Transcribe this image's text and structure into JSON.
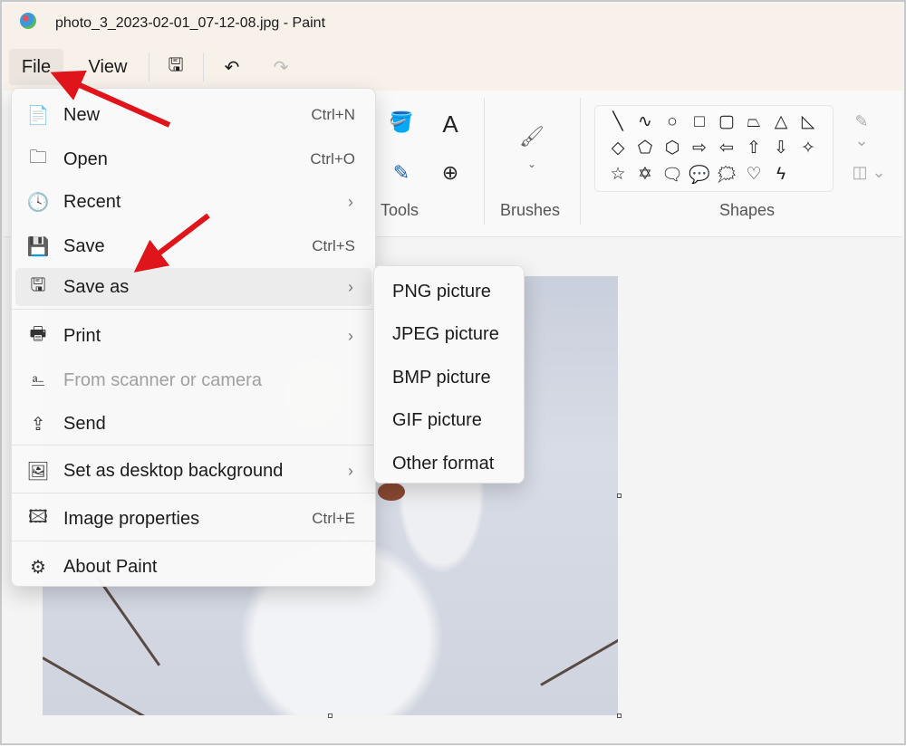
{
  "window": {
    "title": "photo_3_2023-02-01_07-12-08.jpg - Paint"
  },
  "toolbar": {
    "file": "File",
    "view": "View"
  },
  "ribbon": {
    "tools_label": "Tools",
    "brushes_label": "Brushes",
    "shapes_label": "Shapes",
    "shapes": [
      "╲",
      "∿",
      "○",
      "□",
      "▢",
      "⏢",
      "△",
      "◺",
      "◇",
      "⬠",
      "⬡",
      "⇨",
      "⇦",
      "⇧",
      "⇩",
      "✧",
      "☆",
      "✡",
      "🗨",
      "💬",
      "🗯",
      "♡",
      "ϟ"
    ]
  },
  "file_menu": {
    "items": [
      {
        "label": "New",
        "shortcut": "Ctrl+N",
        "icon": "📄"
      },
      {
        "label": "Open",
        "shortcut": "Ctrl+O",
        "icon": "🗀"
      },
      {
        "label": "Recent",
        "shortcut": "",
        "icon": "🕓"
      },
      {
        "label": "Save",
        "shortcut": "Ctrl+S",
        "icon": "💾"
      },
      {
        "label": "Save as",
        "shortcut": "",
        "icon": "🖫"
      },
      {
        "label": "Print",
        "shortcut": "",
        "icon": "🖶"
      },
      {
        "label": "From scanner or camera",
        "shortcut": "",
        "icon": "⎁"
      },
      {
        "label": "Send",
        "shortcut": "",
        "icon": "⇪"
      },
      {
        "label": "Set as desktop background",
        "shortcut": "",
        "icon": "🖼"
      },
      {
        "label": "Image properties",
        "shortcut": "Ctrl+E",
        "icon": "🖾"
      },
      {
        "label": "About Paint",
        "shortcut": "",
        "icon": "⚙"
      }
    ]
  },
  "save_as_submenu": {
    "items": [
      "PNG picture",
      "JPEG picture",
      "BMP picture",
      "GIF picture",
      "Other format"
    ]
  },
  "colors": {
    "annotation_arrow": "#e0141b",
    "highlight": "#ececec"
  }
}
